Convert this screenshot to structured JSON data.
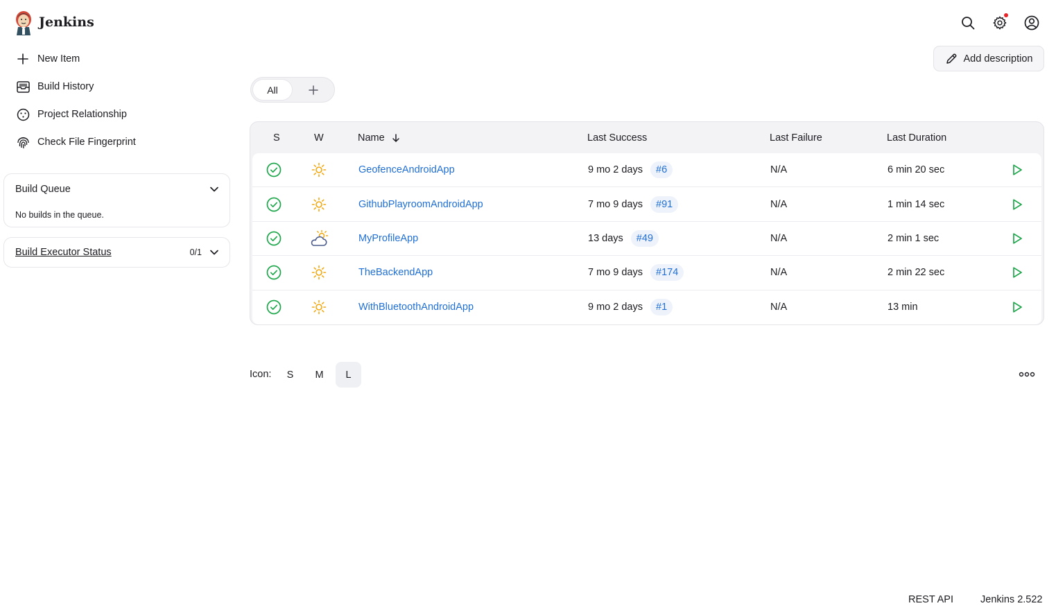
{
  "header": {
    "brand": "Jenkins",
    "icons": [
      "search-icon",
      "gear-icon",
      "user-icon"
    ],
    "notification_color": "#e5252a"
  },
  "sidebar": {
    "items": [
      {
        "label": "New Item",
        "icon": "plus-icon"
      },
      {
        "label": "Build History",
        "icon": "inbox-icon"
      },
      {
        "label": "Project Relationship",
        "icon": "relationship-icon"
      },
      {
        "label": "Check File Fingerprint",
        "icon": "fingerprint-icon"
      }
    ],
    "build_queue": {
      "title": "Build Queue",
      "empty_text": "No builds in the queue."
    },
    "executor": {
      "title": "Build Executor Status",
      "count": "0/1"
    }
  },
  "toolbar": {
    "add_description": "Add description"
  },
  "tabs": {
    "all": "All"
  },
  "table": {
    "columns": {
      "s": "S",
      "w": "W",
      "name": "Name",
      "last_success": "Last Success",
      "last_failure": "Last Failure",
      "last_duration": "Last Duration"
    },
    "rows": [
      {
        "status": "success",
        "weather": "sunny",
        "name": "GeofenceAndroidApp",
        "last_success": "9 mo 2 days",
        "build": "#6",
        "last_failure": "N/A",
        "last_duration": "6 min 20 sec"
      },
      {
        "status": "success",
        "weather": "sunny",
        "name": "GithubPlayroomAndroidApp",
        "last_success": "7 mo 9 days",
        "build": "#91",
        "last_failure": "N/A",
        "last_duration": "1 min 14 sec"
      },
      {
        "status": "success",
        "weather": "partly-cloudy",
        "name": "MyProfileApp",
        "last_success": "13 days",
        "build": "#49",
        "last_failure": "N/A",
        "last_duration": "2 min 1 sec"
      },
      {
        "status": "success",
        "weather": "sunny",
        "name": "TheBackendApp",
        "last_success": "7 mo 9 days",
        "build": "#174",
        "last_failure": "N/A",
        "last_duration": "2 min 22 sec"
      },
      {
        "status": "success",
        "weather": "sunny",
        "name": "WithBluetoothAndroidApp",
        "last_success": "9 mo 2 days",
        "build": "#1",
        "last_failure": "N/A",
        "last_duration": "13 min"
      }
    ],
    "colors": {
      "success": "#1ea64b",
      "sun": "#f2a60c",
      "link": "#1f6fd6"
    }
  },
  "icon_size": {
    "label": "Icon:",
    "options": [
      "S",
      "M",
      "L"
    ],
    "selected": "L"
  },
  "footer": {
    "rest_api": "REST API",
    "version": "Jenkins 2.522"
  }
}
